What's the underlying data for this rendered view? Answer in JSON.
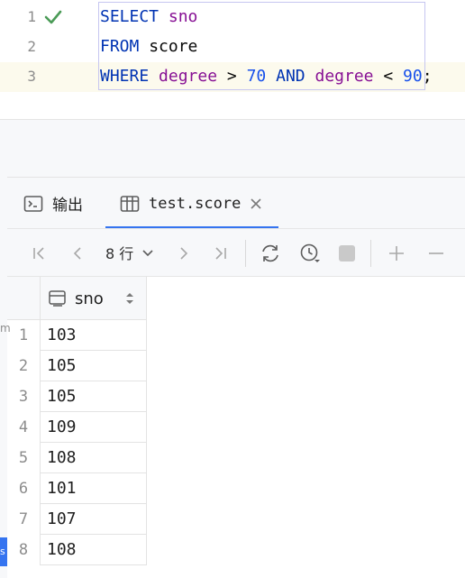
{
  "editor": {
    "lines": [
      {
        "number": "1",
        "tokens": [
          "SELECT",
          "sno"
        ]
      },
      {
        "number": "2",
        "tokens": [
          "FROM",
          "score"
        ]
      },
      {
        "number": "3",
        "tokens": [
          "WHERE",
          "degree",
          ">",
          "70",
          "AND",
          "degree",
          "<",
          "90",
          ";"
        ]
      }
    ],
    "status_icon": "checkmark-icon"
  },
  "tabs": [
    {
      "label": "输出",
      "icon": "console-icon"
    },
    {
      "label": "test.score",
      "icon": "table-icon",
      "active": true
    }
  ],
  "toolbar": {
    "rows_label": "8 行",
    "buttons": [
      "first-page-icon",
      "prev-page-icon",
      "next-page-icon",
      "last-page-icon",
      "refresh-icon",
      "history-icon",
      "stop-icon",
      "add-row-icon",
      "remove-row-icon"
    ]
  },
  "grid": {
    "columns": [
      "sno"
    ],
    "rows": [
      {
        "n": "1",
        "sno": "103"
      },
      {
        "n": "2",
        "sno": "105"
      },
      {
        "n": "3",
        "sno": "105"
      },
      {
        "n": "4",
        "sno": "109"
      },
      {
        "n": "5",
        "sno": "108"
      },
      {
        "n": "6",
        "sno": "101"
      },
      {
        "n": "7",
        "sno": "107"
      },
      {
        "n": "8",
        "sno": "108"
      }
    ]
  },
  "side": {
    "letter": "m",
    "badge": "s"
  },
  "colors": {
    "keyword": "#0033b3",
    "identifier": "#871094",
    "number": "#1750eb",
    "accent": "#3574f0",
    "success": "#4b9b57"
  }
}
